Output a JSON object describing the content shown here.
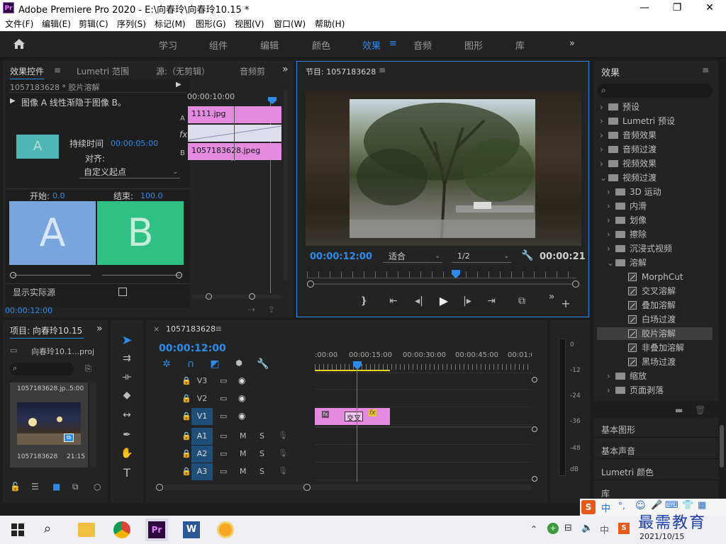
{
  "app": {
    "logo": "Pr",
    "title": "Adobe Premiere Pro 2020 - E:\\向春玲\\向春玲10.15 *"
  },
  "window_controls": {
    "minimize": "—",
    "maximize": "❐",
    "close": "✕"
  },
  "menu": [
    "文件(F)",
    "编辑(E)",
    "剪辑(C)",
    "序列(S)",
    "标记(M)",
    "图形(G)",
    "视图(V)",
    "窗口(W)",
    "帮助(H)"
  ],
  "workspaces": [
    "学习",
    "组件",
    "编辑",
    "颜色",
    "效果",
    "音频",
    "图形",
    "库"
  ],
  "workspace_active_index": 4,
  "effect_controls": {
    "tabs": [
      "效果控件",
      "Lumetri 范围",
      "源:（无剪辑）",
      "音频剪"
    ],
    "clip_title": "1057183628 * 胶片溶解",
    "description": "图像 A 线性渐隐于图像 B。",
    "duration_label": "持续时间",
    "duration_value": "00:00:05:00",
    "align_label": "对齐:",
    "align_value": "自定义起点",
    "start_label": "开始:",
    "start_value": "0.0",
    "end_label": "结束:",
    "end_value": "100.0",
    "a_letter": "A",
    "b_letter": "B",
    "show_actual": "显示实际源",
    "timecode": "00:00:10:00",
    "clip_a": "1111.jpg",
    "clip_b": "1057183628.jpeg",
    "track_a": "A",
    "track_fx": "fx",
    "track_b": "B",
    "bottom_time": "00:00:12:00",
    "thumb_letter": "A"
  },
  "program": {
    "title": "节目: 1057183628",
    "time_current": "00:00:12:00",
    "fit": "适合",
    "quality": "1/2",
    "time_total": "00:00:21"
  },
  "effects_panel": {
    "title": "效果",
    "items": [
      {
        "label": "预设",
        "level": 0,
        "type": "folder-star"
      },
      {
        "label": "Lumetri 预设",
        "level": 0,
        "type": "folder-star"
      },
      {
        "label": "音频效果",
        "level": 0,
        "type": "folder"
      },
      {
        "label": "音频过渡",
        "level": 0,
        "type": "folder"
      },
      {
        "label": "视频效果",
        "level": 0,
        "type": "folder"
      },
      {
        "label": "视频过渡",
        "level": 0,
        "type": "folder",
        "open": true
      },
      {
        "label": "3D 运动",
        "level": 1,
        "type": "folder"
      },
      {
        "label": "内滑",
        "level": 1,
        "type": "folder"
      },
      {
        "label": "划像",
        "level": 1,
        "type": "folder"
      },
      {
        "label": "擦除",
        "level": 1,
        "type": "folder"
      },
      {
        "label": "沉浸式视频",
        "level": 1,
        "type": "folder"
      },
      {
        "label": "溶解",
        "level": 1,
        "type": "folder",
        "open": true
      },
      {
        "label": "MorphCut",
        "level": 2,
        "type": "fx"
      },
      {
        "label": "交叉溶解",
        "level": 2,
        "type": "fx"
      },
      {
        "label": "叠加溶解",
        "level": 2,
        "type": "fx"
      },
      {
        "label": "白场过渡",
        "level": 2,
        "type": "fx"
      },
      {
        "label": "胶片溶解",
        "level": 2,
        "type": "fx",
        "selected": true
      },
      {
        "label": "非叠加溶解",
        "level": 2,
        "type": "fx"
      },
      {
        "label": "黑场过渡",
        "level": 2,
        "type": "fx"
      },
      {
        "label": "缩放",
        "level": 1,
        "type": "folder"
      },
      {
        "label": "页面剥落",
        "level": 1,
        "type": "folder"
      }
    ],
    "sections": [
      "基本图形",
      "基本声音",
      "Lumetri 颜色",
      "库"
    ]
  },
  "project": {
    "title": "项目: 向春玲10.15",
    "proj_file": "向春玲10.1...proj",
    "item_name_top": "1057183628.jp...",
    "item_duration_top": "5:00",
    "item_name": "1057183628",
    "item_duration": "21:15"
  },
  "timeline": {
    "title": "1057183628",
    "timecode": "00:00:12:00",
    "ruler": [
      ":00:00",
      "00:00:15:00",
      "00:00:30:00",
      "00:00:45:00",
      "00:01:0"
    ],
    "tracks": [
      {
        "name": "V3",
        "kind": "video"
      },
      {
        "name": "V2",
        "kind": "video"
      },
      {
        "name": "V1",
        "kind": "video",
        "on": true
      },
      {
        "name": "A1",
        "kind": "audio",
        "on": true
      },
      {
        "name": "A2",
        "kind": "audio",
        "on": true
      },
      {
        "name": "A3",
        "kind": "audio",
        "on": true
      }
    ],
    "mute": "M",
    "solo": "S",
    "clip_fx1": "fx",
    "clip_label": "交叉",
    "clip_fx2": "fx"
  },
  "meters": [
    "0",
    "-12",
    "-24",
    "-36",
    "-48",
    "dB"
  ],
  "ime": [
    "中",
    "°,",
    "☺",
    "🎤",
    "⌨",
    "👕",
    "▦"
  ],
  "taskbar": {
    "date": "2021/10/15",
    "watermark": "最需教育"
  },
  "colors": {
    "accent": "#2d8ceb",
    "clip": "#e48ae0",
    "a_box": "#78a5dc",
    "b_box": "#2fc085"
  }
}
